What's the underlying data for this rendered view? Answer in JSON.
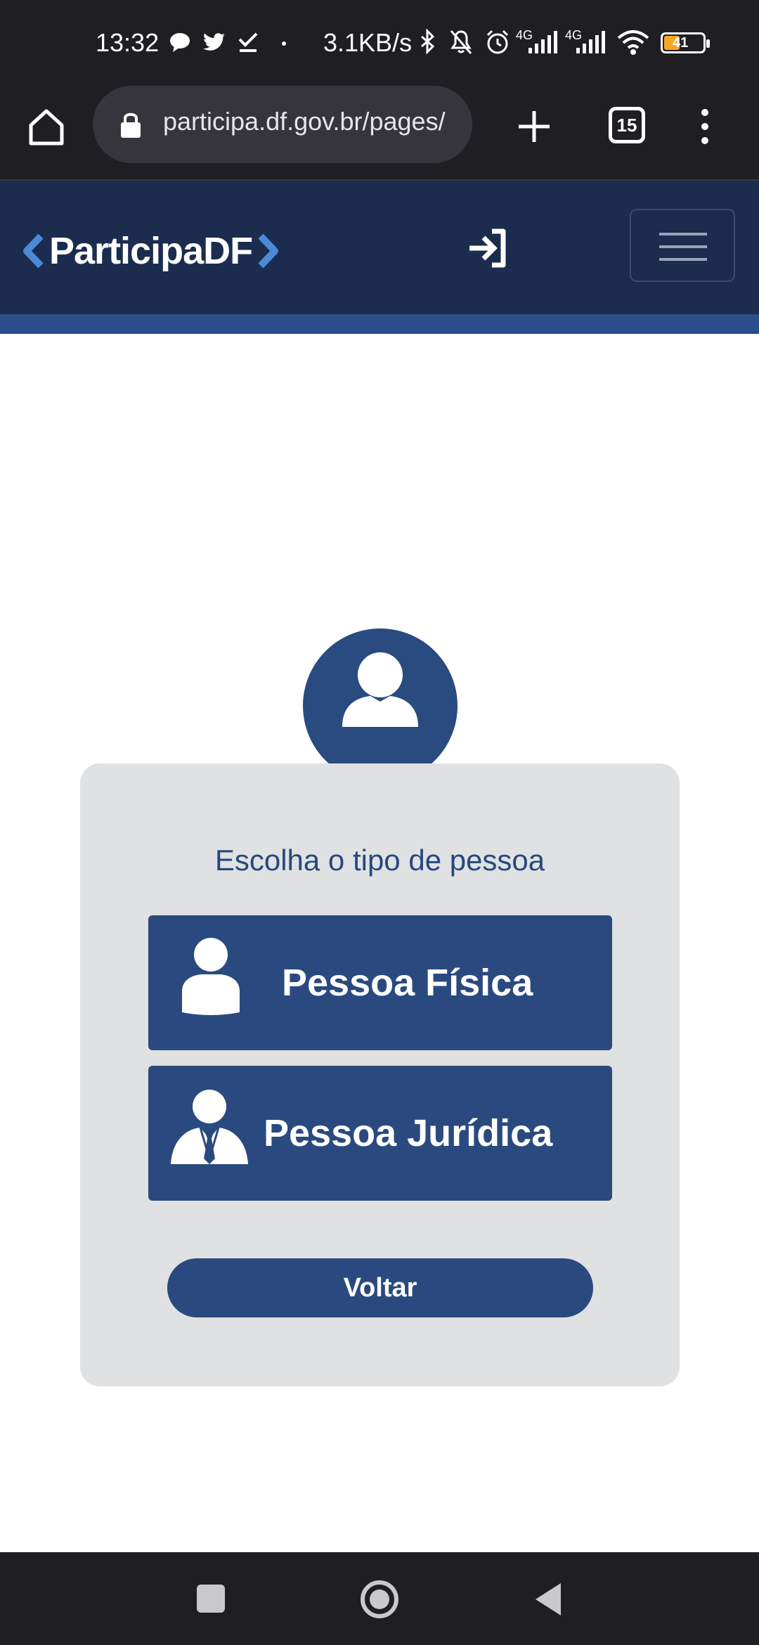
{
  "status_bar": {
    "time": "13:32",
    "network_speed": "3.1KB/s",
    "network_type_1": "4G",
    "network_type_2": "4G",
    "battery": "41"
  },
  "browser": {
    "url": "participa.df.gov.br/pages/",
    "tab_count": "15"
  },
  "header": {
    "logo_text": "ParticipaDF"
  },
  "card": {
    "title": "Escolha o tipo de pessoa",
    "option_fisica": "Pessoa Física",
    "option_juridica": "Pessoa Jurídica",
    "back_label": "Voltar"
  },
  "colors": {
    "primary": "#2a4a7f",
    "header": "#1b2c4f",
    "accent_strip": "#2b4e8c",
    "card_bg": "#e0e1e2"
  }
}
